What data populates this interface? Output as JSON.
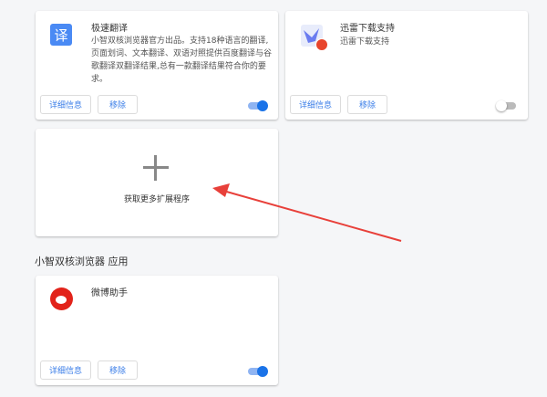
{
  "extensions": [
    {
      "name": "极速翻译",
      "description": "小智双核浏览器官方出品。支持18种语言的翻译,页面划词、文本翻译、双语对照提供百度翻译与谷歌翻译双翻译结果,总有一款翻译结果符合你的要求。",
      "icon_glyph": "译",
      "details": "详细信息",
      "remove": "移除",
      "enabled": true
    },
    {
      "name": "迅雷下载支持",
      "description": "迅雷下载支持",
      "details": "详细信息",
      "remove": "移除",
      "enabled": false
    }
  ],
  "add_more": {
    "icon": "plus-icon",
    "label": "获取更多扩展程序"
  },
  "apps_section": {
    "title": "小智双核浏览器 应用"
  },
  "apps": [
    {
      "name": "微博助手",
      "details": "详细信息",
      "remove": "移除",
      "enabled": true
    }
  ],
  "colors": {
    "accent": "#1a73e8",
    "arrow": "#e8403a"
  }
}
